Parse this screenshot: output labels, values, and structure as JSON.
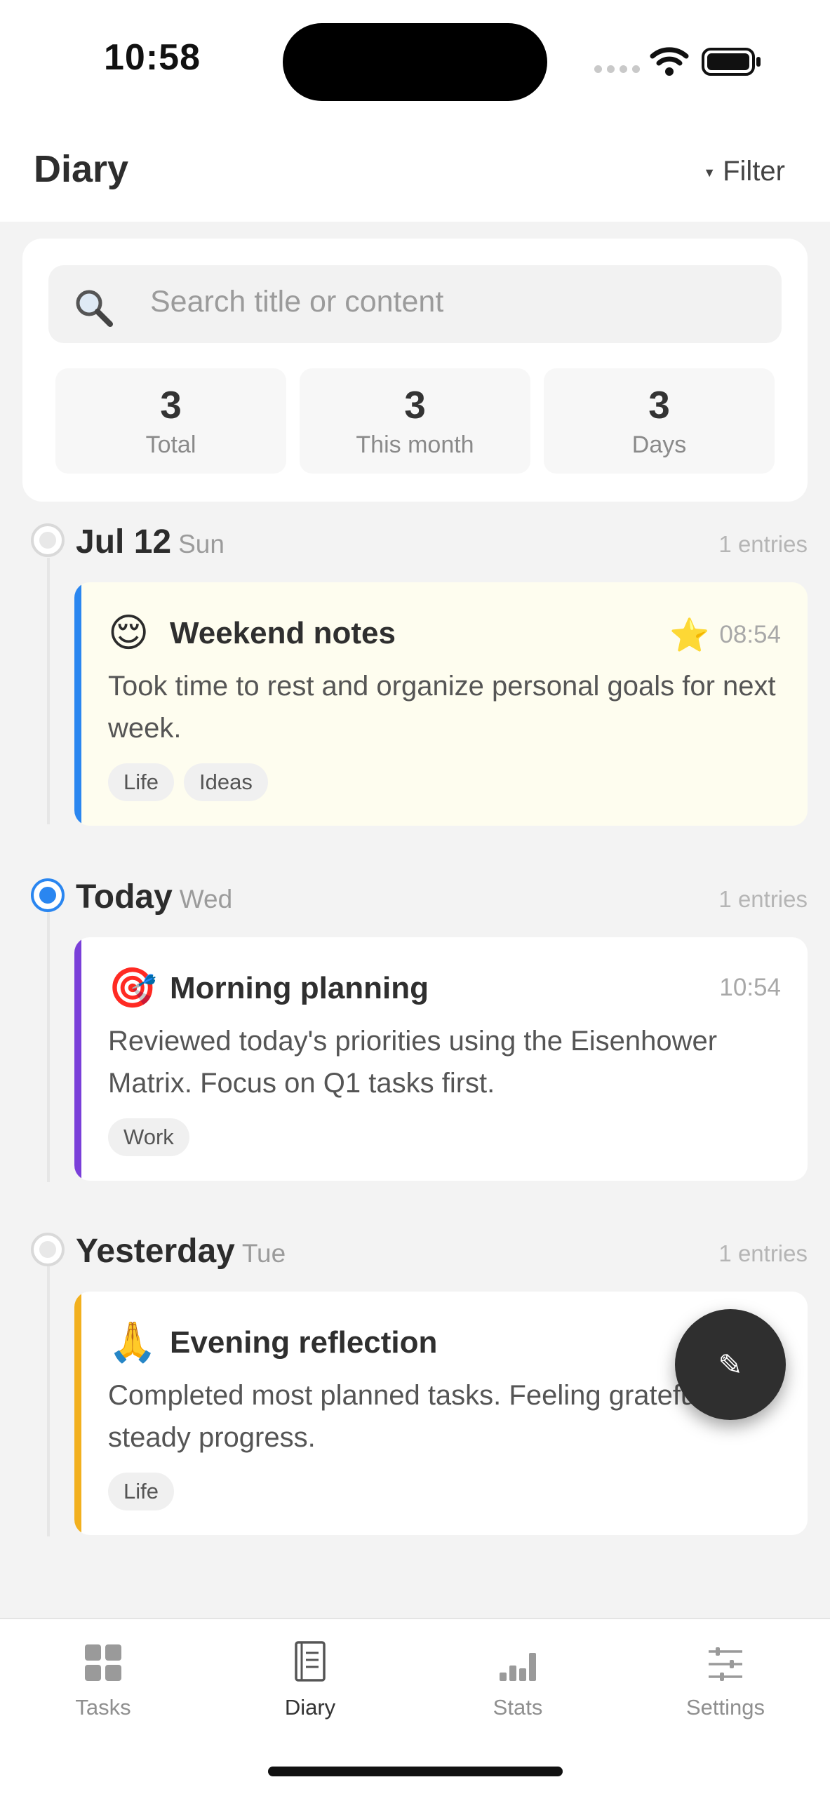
{
  "status_bar": {
    "time": "10:58"
  },
  "header": {
    "title": "Diary",
    "filter_label": "Filter"
  },
  "search": {
    "placeholder": "Search title or content"
  },
  "stats": [
    {
      "value": "3",
      "label": "Total"
    },
    {
      "value": "3",
      "label": "This month"
    },
    {
      "value": "3",
      "label": "Days"
    }
  ],
  "groups": [
    {
      "date": "Jul 12",
      "weekday": "Sun",
      "count": "1 entries",
      "active": false,
      "entry": {
        "emoji": "😌",
        "title": "Weekend notes",
        "starred": true,
        "star": "⭐",
        "time": "08:54",
        "body": "Took time to rest and organize personal goals for next week.",
        "tags": [
          "Life",
          "Ideas"
        ],
        "accent": "#2a86f0",
        "highlight": true
      }
    },
    {
      "date": "Today",
      "weekday": "Wed",
      "count": "1 entries",
      "active": true,
      "entry": {
        "emoji": "🎯",
        "title": "Morning planning",
        "starred": false,
        "time": "10:54",
        "body": "Reviewed today's priorities using the Eisenhower Matrix. Focus on Q1 tasks first.",
        "tags": [
          "Work"
        ],
        "accent": "#7a3fd9",
        "highlight": false
      }
    },
    {
      "date": "Yesterday",
      "weekday": "Tue",
      "count": "1 entries",
      "active": false,
      "entry": {
        "emoji": "🙏",
        "title": "Evening reflection",
        "starred": false,
        "time": "",
        "body": "Completed most planned tasks. Feeling grateful for steady progress.",
        "tags": [
          "Life"
        ],
        "accent": "#f2b01e",
        "highlight": false
      }
    }
  ],
  "fab": {
    "icon": "✎"
  },
  "tabbar": {
    "items": [
      {
        "label": "Tasks",
        "icon": "grid-icon",
        "active": false
      },
      {
        "label": "Diary",
        "icon": "notebook-icon",
        "active": true
      },
      {
        "label": "Stats",
        "icon": "bar-chart-icon",
        "active": false
      },
      {
        "label": "Settings",
        "icon": "sliders-icon",
        "active": false
      }
    ]
  }
}
